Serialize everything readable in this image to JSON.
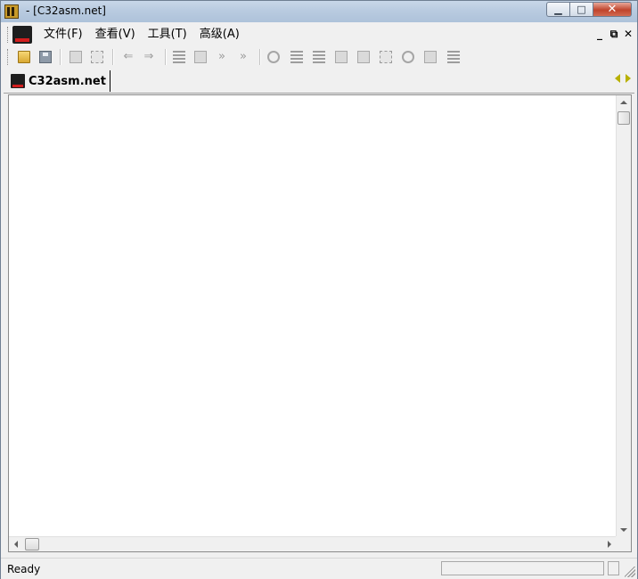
{
  "window": {
    "title": "- [C32asm.net]"
  },
  "menu": {
    "items": [
      {
        "label": "文件(F)",
        "name": "menu-file"
      },
      {
        "label": "查看(V)",
        "name": "menu-view"
      },
      {
        "label": "工具(T)",
        "name": "menu-tools"
      },
      {
        "label": "高级(A)",
        "name": "menu-advanced"
      }
    ]
  },
  "mdi": {
    "minimize": "_",
    "restore": "⧉",
    "close": "✕"
  },
  "toolbar": {
    "buttons": [
      "open-icon",
      "save-icon",
      "copy-icon",
      "find-icon",
      "back-icon",
      "forward-icon",
      "goto-icon",
      "goto-address-icon",
      "step-icon",
      "step-over-icon",
      "run-icon",
      "list-icon",
      "indent-icon",
      "format-icon",
      "hex-icon",
      "dots-icon",
      "gear-icon",
      "bar-icon",
      "grid-icon"
    ]
  },
  "tab": {
    "label": "C32asm.net"
  },
  "status": {
    "text": "Ready"
  },
  "colors": {
    "tab_nav": "#b8b000",
    "titlebar": "#b9cbe0",
    "close": "#c0442c"
  }
}
